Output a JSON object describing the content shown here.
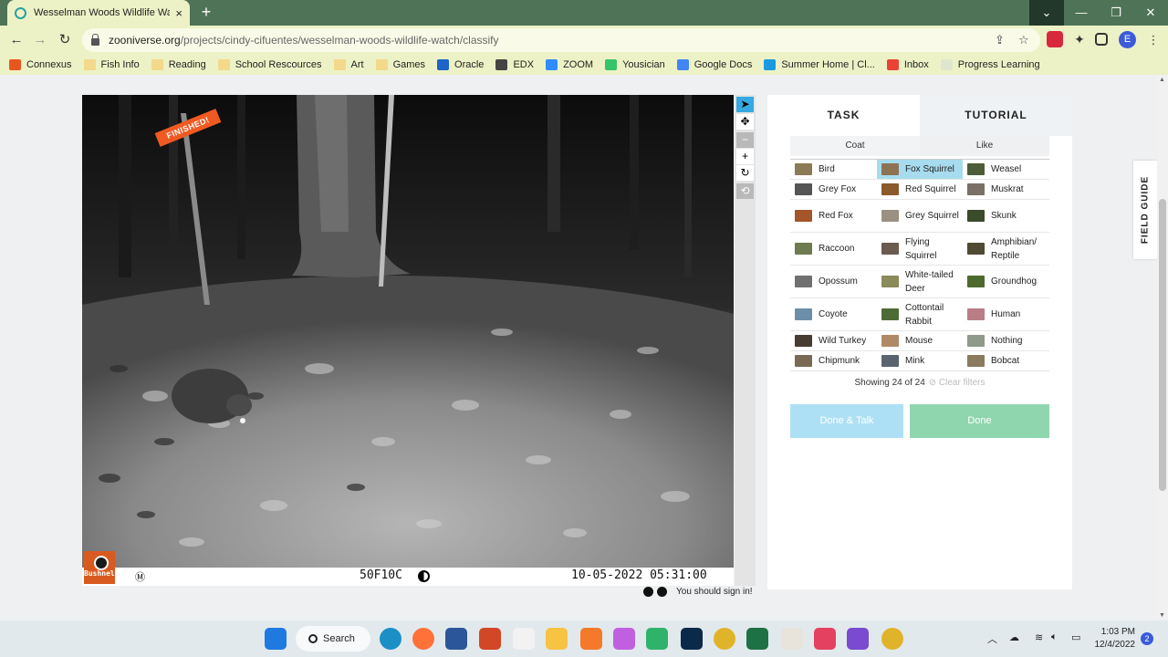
{
  "browser": {
    "tab_title": "Wesselman Woods Wildlife Watc",
    "tab_close": "×",
    "new_tab": "+",
    "url_host": "zooniverse.org",
    "url_path": "/projects/cindy-cifuentes/wesselman-woods-wildlife-watch/classify",
    "profile_initial": "E",
    "window_controls": [
      "⌄",
      "—",
      "❐",
      "✕"
    ]
  },
  "bookmarks": [
    {
      "label": "Connexus",
      "icon": "connexus-icon",
      "color": "#e8561f"
    },
    {
      "label": "Fish Info",
      "icon": "folder-icon",
      "color": "#f3d98c"
    },
    {
      "label": "Reading",
      "icon": "folder-icon",
      "color": "#f3d98c"
    },
    {
      "label": "School Rescources",
      "icon": "folder-icon",
      "color": "#f3d98c"
    },
    {
      "label": "Art",
      "icon": "folder-icon",
      "color": "#f3d98c"
    },
    {
      "label": "Games",
      "icon": "folder-icon",
      "color": "#f3d98c"
    },
    {
      "label": "Oracle",
      "icon": "cloud-icon",
      "color": "#1e63c8"
    },
    {
      "label": "EDX",
      "icon": "edx-icon",
      "color": "#444444"
    },
    {
      "label": "ZOOM",
      "icon": "zoom-icon",
      "color": "#2d8cff"
    },
    {
      "label": "Yousician",
      "icon": "yousician-icon",
      "color": "#35c46a"
    },
    {
      "label": "Google Docs",
      "icon": "docs-icon",
      "color": "#4285f4"
    },
    {
      "label": "Summer Home | Cl...",
      "icon": "summer-icon",
      "color": "#1a9ae0"
    },
    {
      "label": "Inbox",
      "icon": "gmail-icon",
      "color": "#ea4335"
    },
    {
      "label": "Progress Learning",
      "icon": "progress-icon",
      "color": "#dfe6cf"
    }
  ],
  "subject": {
    "ribbon": "FINISHED!",
    "brand": "Bushnell",
    "moon_symbol": "Ⓜ",
    "temp_code": "50F10C",
    "timestamp": "10-05-2022  05:31:00"
  },
  "viewer_tools": [
    {
      "name": "pointer-tool",
      "glyph": "➤",
      "state": "sel"
    },
    {
      "name": "pan-tool",
      "glyph": "✥",
      "state": "on"
    },
    {
      "name": "zoom-out-tool",
      "glyph": "−",
      "state": "dim"
    },
    {
      "name": "zoom-in-tool",
      "glyph": "+",
      "state": "on"
    },
    {
      "name": "rotate-tool",
      "glyph": "↻",
      "state": "on"
    },
    {
      "name": "reset-tool",
      "glyph": "⟲",
      "state": "dim"
    }
  ],
  "sign_in": "You should sign in!",
  "panel": {
    "tab_task": "TASK",
    "tab_tutorial": "TUTORIAL",
    "filter_coat": "Coat",
    "filter_like": "Like",
    "showing": "Showing 24 of 24",
    "clear_filters": "⊘ Clear filters",
    "done_talk": "Done & Talk",
    "done": "Done",
    "field_guide": "FIELD GUIDE"
  },
  "species_rows": [
    [
      {
        "label": "Bird",
        "color": "#8a7a55"
      },
      {
        "label": "Fox Squirrel",
        "color": "#8c7356",
        "selected": true
      },
      {
        "label": "Weasel",
        "color": "#4f5c3a"
      }
    ],
    [
      {
        "label": "Grey Fox",
        "color": "#555555"
      },
      {
        "label": "Red Squirrel",
        "color": "#8a5a2b"
      },
      {
        "label": "Muskrat",
        "color": "#7a7066"
      }
    ],
    [
      {
        "label": "Red Fox",
        "color": "#a4552a"
      },
      {
        "label": "Grey Squirrel",
        "color": "#9a9183"
      },
      {
        "label": "Skunk",
        "color": "#3a4a2a"
      }
    ],
    [
      {
        "label": "Raccoon",
        "color": "#6e7a50"
      },
      {
        "label": "Flying Squirrel",
        "color": "#6b5a4e"
      },
      {
        "label": "Amphibian/ Reptile",
        "color": "#4f4a33"
      }
    ],
    [
      {
        "label": "Opossum",
        "color": "#707070"
      },
      {
        "label": "White-tailed Deer",
        "color": "#8b8a5a"
      },
      {
        "label": "Groundhog",
        "color": "#4c6a2e"
      }
    ],
    [
      {
        "label": "Coyote",
        "color": "#6d8ea8"
      },
      {
        "label": "Cottontail Rabbit",
        "color": "#4d6b35"
      },
      {
        "label": "Human",
        "color": "#b97d86"
      }
    ],
    [
      {
        "label": "Wild Turkey",
        "color": "#463c30"
      },
      {
        "label": "Mouse",
        "color": "#b08a66"
      },
      {
        "label": "Nothing",
        "color": "#8e9a8a"
      }
    ],
    [
      {
        "label": "Chipmunk",
        "color": "#7a6a55"
      },
      {
        "label": "Mink",
        "color": "#5a6470"
      },
      {
        "label": "Bobcat",
        "color": "#8a7a5e"
      }
    ]
  ],
  "taskbar": {
    "search_label": "Search",
    "time": "1:03 PM",
    "date": "12/4/2022",
    "notifications": "2",
    "apps": [
      {
        "name": "windows-start-icon",
        "color": "#1f7ae0"
      },
      {
        "name": "edge-icon",
        "color": "#1c8fc7"
      },
      {
        "name": "firefox-icon",
        "color": "#ff7139"
      },
      {
        "name": "word-icon",
        "color": "#2b579a"
      },
      {
        "name": "powerpoint-icon",
        "color": "#d24726"
      },
      {
        "name": "panda-app-icon",
        "color": "#f2f2f2"
      },
      {
        "name": "file-explorer-icon",
        "color": "#f6c343"
      },
      {
        "name": "blender-icon",
        "color": "#f5792a"
      },
      {
        "name": "color-app-icon",
        "color": "#c060e0"
      },
      {
        "name": "robot-app-icon",
        "color": "#2fb36a"
      },
      {
        "name": "lightroom-icon",
        "color": "#0b2a4a"
      },
      {
        "name": "chrome-icon",
        "color": "#e0b42a"
      },
      {
        "name": "excel-icon",
        "color": "#1e7145"
      },
      {
        "name": "paint-icon",
        "color": "#e8e4dc"
      },
      {
        "name": "instagram-icon",
        "color": "#e4405f"
      },
      {
        "name": "clapper-icon",
        "color": "#7a4ad0"
      },
      {
        "name": "chrome-profile-icon",
        "color": "#e0b42a"
      }
    ]
  }
}
